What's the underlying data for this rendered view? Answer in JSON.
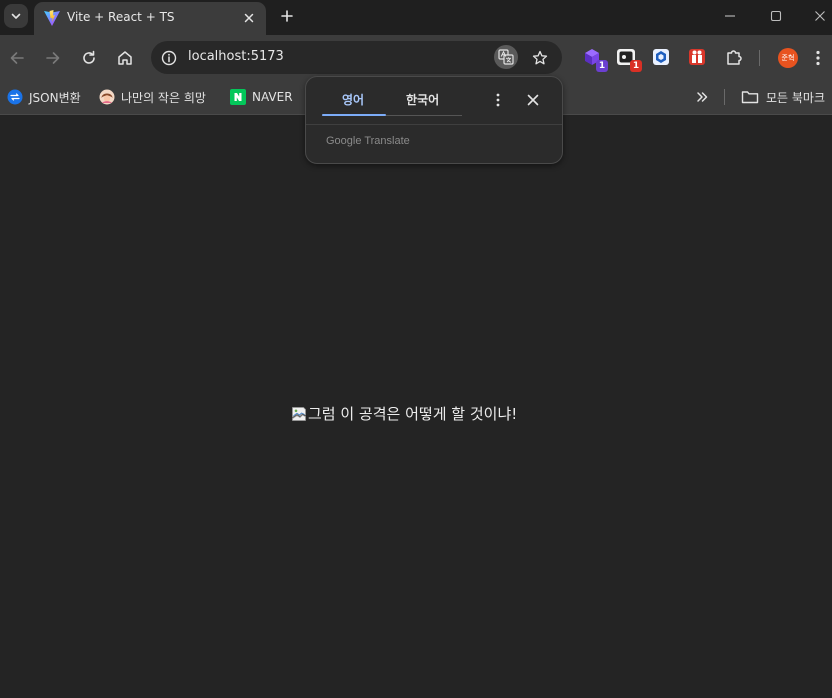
{
  "browser": {
    "tab": {
      "title": "Vite + React + TS"
    },
    "url": "localhost:5173",
    "profile_label": "준혁"
  },
  "extensions": [
    {
      "icon": "purple-cube-extension-icon",
      "badge": "1",
      "badge_color": "#6b3fd1"
    },
    {
      "icon": "dark-box-extension-icon",
      "badge": "1",
      "badge_color": "#d93025"
    },
    {
      "icon": "blue-shield-extension-icon",
      "badge": "",
      "badge_color": ""
    },
    {
      "icon": "red-gift-extension-icon",
      "badge": "",
      "badge_color": ""
    }
  ],
  "bookmarks": {
    "items": [
      {
        "label": "JSON변환",
        "icon": "json-convert-icon",
        "color": "#1a73e8"
      },
      {
        "label": "나만의 작은 희망",
        "icon": "avatar-icon",
        "color": "#f0a06a"
      },
      {
        "label": "NAVER",
        "icon": "naver-icon",
        "color": "#03c75a"
      }
    ],
    "all_bookmarks": "모든 북마크"
  },
  "translate_popup": {
    "source_lang": "영어",
    "target_lang": "한국어",
    "brand": "Google Translate",
    "accent": "#7cacf8"
  },
  "content": {
    "image_alt": "그럼 이 공격은 어떻게 할 것이냐!"
  }
}
